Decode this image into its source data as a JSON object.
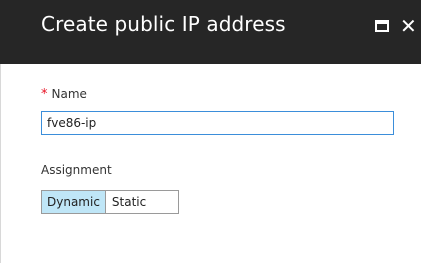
{
  "blade": {
    "title": "Create public IP address",
    "maximize_icon": "maximize-icon",
    "close_icon": "close-icon",
    "close_glyph": "✕"
  },
  "form": {
    "name": {
      "required_marker": "*",
      "label": "Name",
      "value": "fve86-ip"
    },
    "assignment": {
      "label": "Assignment",
      "options": [
        "Dynamic",
        "Static"
      ],
      "selected": "Dynamic"
    }
  },
  "colors": {
    "header_bg": "#262626",
    "selected_option_bg": "#bfe6f7",
    "input_focus_border": "#3b8eda",
    "required_marker": "#e81123"
  }
}
